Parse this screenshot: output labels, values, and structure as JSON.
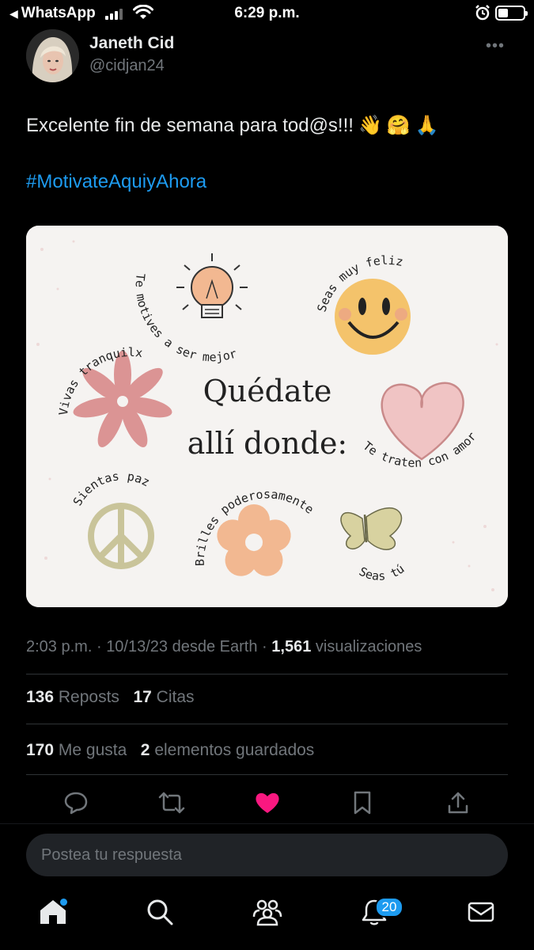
{
  "status_bar": {
    "back_app": "WhatsApp",
    "time": "6:29 p.m."
  },
  "author": {
    "name": "Janeth Cid",
    "handle": "@cidjan24"
  },
  "tweet": {
    "text": "Excelente fin de semana para tod@s!!!",
    "emojis": [
      "👋",
      "🤗",
      "🙏"
    ],
    "hashtag": "#MotivateAquiyAhora"
  },
  "image": {
    "title_line1": "Quédate",
    "title_line2": "allí donde:",
    "phrases": {
      "motives": "Te motives a ser mejor",
      "feliz": "Seas muy feliz",
      "tranquilx": "Vivas tranquilx",
      "amor": "Te traten con amor",
      "paz": "Sientas paz",
      "brilles": "Brilles poderosamente",
      "tu": "Seas tú"
    }
  },
  "meta": {
    "time": "2:03 p.m.",
    "sep1": "·",
    "date": "10/13/23",
    "source": "desde Earth",
    "sep2": "·",
    "views_count": "1,561",
    "views_label": "visualizaciones"
  },
  "stats": {
    "reposts_count": "136",
    "reposts_label": "Reposts",
    "quotes_count": "17",
    "quotes_label": "Citas",
    "likes_count": "170",
    "likes_label": "Me gusta",
    "bookmarks_count": "2",
    "bookmarks_label": "elementos guardados"
  },
  "actions": {
    "reply_icon": "reply-icon",
    "repost_icon": "repost-icon",
    "like_icon": "heart-icon",
    "like_color": "#f91880",
    "bookmark_icon": "bookmark-icon",
    "share_icon": "share-icon"
  },
  "reply": {
    "placeholder": "Postea tu respuesta"
  },
  "tabbar": {
    "notifications_badge": "20",
    "accent": "#1d9bf0"
  }
}
